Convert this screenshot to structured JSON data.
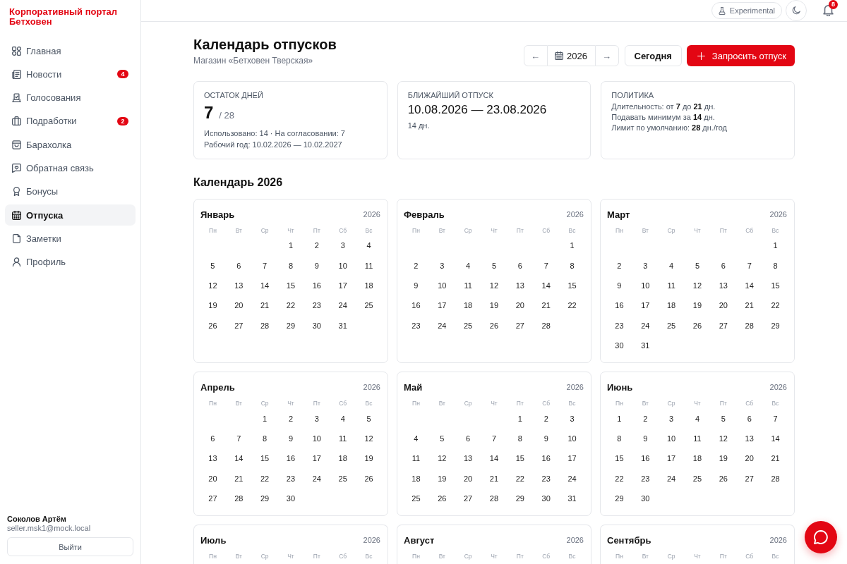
{
  "sidebar": {
    "brand": "Корпоративный портал Бетховен",
    "items": [
      {
        "label": "Главная",
        "selected": false
      },
      {
        "label": "Новости",
        "badge": "4",
        "selected": false
      },
      {
        "label": "Голосования",
        "selected": false
      },
      {
        "label": "Подработки",
        "badge": "2",
        "selected": false
      },
      {
        "label": "Барахолка",
        "selected": false
      },
      {
        "label": "Обратная связь",
        "selected": false
      },
      {
        "label": "Бонусы",
        "selected": false
      },
      {
        "label": "Отпуска",
        "selected": true
      },
      {
        "label": "Заметки",
        "selected": false
      },
      {
        "label": "Профиль",
        "selected": false
      }
    ],
    "user": {
      "name": "Соколов Артём",
      "email": "seller.msk1@mock.local"
    },
    "logout_button": "Выйти"
  },
  "topbar": {
    "experimental_button": "Experimental",
    "notifications_count": "8"
  },
  "header": {
    "title": "Календарь отпусков",
    "subtitle": "Магазин «Бетховен Тверская»",
    "prev_button": "←",
    "year_button": "2026",
    "next_button": "→",
    "today_button": "Сегодня",
    "request_button": "Запросить отпуск"
  },
  "summary_cards": [
    {
      "kind": "balance",
      "label": "ОСТАТОК ДНЕЙ",
      "value": "7",
      "total": "/ 28",
      "lines": [
        "Использовано: 14 · На согласовании: 7",
        "Рабочий год: 10.02.2026 — 10.02.2027"
      ]
    },
    {
      "kind": "upcoming",
      "label": "БЛИЖАЙШИЙ ОТПУСК",
      "value": "10.08.2026 — 23.08.2026",
      "lines": [
        "14 дн."
      ]
    },
    {
      "kind": "policy",
      "label": "ПОЛИТИКА",
      "lines": [
        "Длительность: от **7** до **21** дн.",
        "Подавать минимум за **14** дн.",
        "Лимит по умолчанию: **28** дн./год"
      ]
    }
  ],
  "calendar": {
    "title": "Календарь 2026",
    "months": [
      {
        "name": "Январь",
        "year": "2026",
        "weekdays": [
          "Пн",
          "Вт",
          "Ср",
          "Чт",
          "Пт",
          "Сб",
          "Вс"
        ],
        "weeks": [
          [
            "1",
            "2",
            "3",
            "4"
          ],
          [
            "5",
            "6",
            "7",
            "8",
            "9",
            "10",
            "11"
          ],
          [
            "12",
            "13",
            "14",
            "15",
            "16",
            "17",
            "18"
          ],
          [
            "19",
            "20",
            "21",
            "22",
            "23",
            "24",
            "25"
          ],
          [
            "26",
            "27",
            "28",
            "29",
            "30",
            "31"
          ]
        ]
      },
      {
        "name": "Февраль",
        "year": "2026",
        "weekdays": [
          "Пн",
          "Вт",
          "Ср",
          "Чт",
          "Пт",
          "Сб",
          "Вс"
        ],
        "weeks": [
          [
            "1"
          ],
          [
            "2",
            "3",
            "4",
            "5",
            "6",
            "7",
            "8"
          ],
          [
            "9",
            "10",
            "11",
            "12",
            "13",
            "14",
            "15"
          ],
          [
            "16",
            "17",
            "18",
            "19",
            "20",
            "21",
            "22"
          ],
          [
            "23",
            "24",
            "25",
            "26",
            "27",
            "28"
          ]
        ]
      },
      {
        "name": "Март",
        "year": "2026",
        "weekdays": [
          "Пн",
          "Вт",
          "Ср",
          "Чт",
          "Пт",
          "Сб",
          "Вс"
        ],
        "weeks": [
          [
            "1"
          ],
          [
            "2",
            "3",
            "4",
            "5",
            "6",
            "7",
            "8"
          ],
          [
            "9",
            "10",
            "11",
            "12",
            "13",
            "14",
            "15"
          ],
          [
            "16",
            "17",
            "18",
            "19",
            "20",
            "21",
            "22"
          ],
          [
            "23",
            "24",
            "25",
            "26",
            "27",
            "28",
            "29"
          ],
          [
            "30",
            "31"
          ]
        ]
      },
      {
        "name": "Апрель",
        "year": "2026",
        "weekdays": [
          "Пн",
          "Вт",
          "Ср",
          "Чт",
          "Пт",
          "Сб",
          "Вс"
        ],
        "weeks": [
          [
            "1",
            "2",
            "3",
            "4",
            "5"
          ],
          [
            "6",
            "7",
            "8",
            "9",
            "10",
            "11",
            "12"
          ],
          [
            "13",
            "14",
            "15",
            "16",
            "17",
            "18",
            "19"
          ],
          [
            "20",
            "21",
            "22",
            "23",
            "24",
            "25",
            "26"
          ],
          [
            "27",
            "28",
            "29",
            "30"
          ]
        ]
      },
      {
        "name": "Май",
        "year": "2026",
        "weekdays": [
          "Пн",
          "Вт",
          "Ср",
          "Чт",
          "Пт",
          "Сб",
          "Вс"
        ],
        "weeks": [
          [
            "1",
            "2",
            "3"
          ],
          [
            "4",
            "5",
            "6",
            "7",
            "8",
            "9",
            "10"
          ],
          [
            "11",
            "12",
            "13",
            "14",
            "15",
            "16",
            "17"
          ],
          [
            "18",
            "19",
            "20",
            "21",
            "22",
            "23",
            "24"
          ],
          [
            "25",
            "26",
            "27",
            "28",
            "29",
            "30",
            "31"
          ]
        ]
      },
      {
        "name": "Июнь",
        "year": "2026",
        "weekdays": [
          "Пн",
          "Вт",
          "Ср",
          "Чт",
          "Пт",
          "Сб",
          "Вс"
        ],
        "weeks": [
          [
            "1",
            "2",
            "3",
            "4",
            "5",
            "6",
            "7"
          ],
          [
            "8",
            "9",
            "10",
            "11",
            "12",
            "13",
            "14"
          ],
          [
            "15",
            "16",
            "17",
            "18",
            "19",
            "20",
            "21"
          ],
          [
            "22",
            "23",
            "24",
            "25",
            "26",
            "27",
            "28"
          ],
          [
            "29",
            "30"
          ]
        ]
      },
      {
        "name": "Июль",
        "year": "2026",
        "weekdays": [
          "Пн",
          "Вт",
          "Ср",
          "Чт",
          "Пт",
          "Сб",
          "Вс"
        ]
      },
      {
        "name": "Август",
        "year": "2026",
        "weekdays": [
          "Пн",
          "Вт",
          "Ср",
          "Чт",
          "Пт",
          "Сб",
          "Вс"
        ]
      },
      {
        "name": "Сентябрь",
        "year": "2026",
        "weekdays": [
          "Пн",
          "Вт",
          "Ср",
          "Чт",
          "Пт",
          "Сб",
          "Вс"
        ]
      }
    ]
  }
}
